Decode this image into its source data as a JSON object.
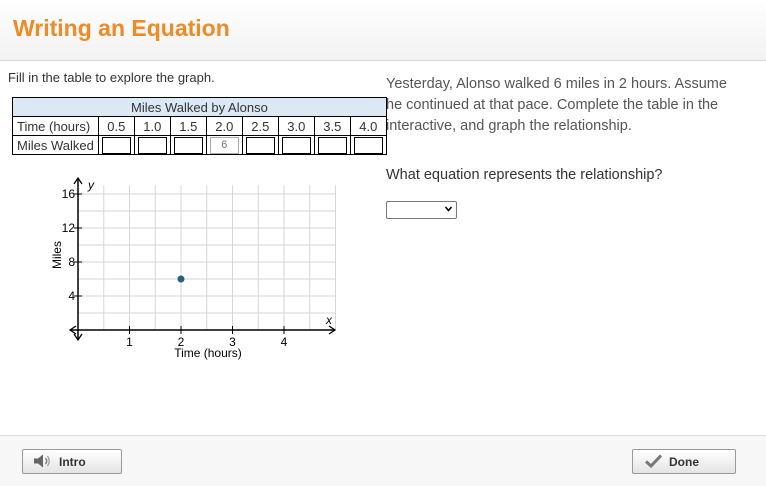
{
  "header": {
    "title": "Writing an Equation"
  },
  "left": {
    "instructions": "Fill in the table to explore the graph.",
    "table": {
      "caption": "Miles Walked by Alonso",
      "row1_label": "Time (hours)",
      "times": [
        "0.5",
        "1.0",
        "1.5",
        "2.0",
        "2.5",
        "3.0",
        "3.5",
        "4.0"
      ],
      "row2_label": "Miles Walked",
      "miles": [
        "",
        "",
        "",
        "6",
        "",
        "",
        "",
        ""
      ]
    },
    "graph": {
      "y_var": "y",
      "x_var": "x",
      "ylabel": "Miles",
      "xlabel": "Time (hours)",
      "y_ticks": [
        "4",
        "8",
        "12",
        "16"
      ],
      "x_ticks": [
        "1",
        "2",
        "3",
        "4"
      ],
      "point_color": "#2b5f7a"
    }
  },
  "chart_data": {
    "type": "scatter",
    "x": [
      2
    ],
    "y": [
      6
    ],
    "xlabel": "Time (hours)",
    "ylabel": "Miles",
    "xlim": [
      0,
      5
    ],
    "ylim": [
      0,
      17
    ],
    "grid": true
  },
  "right": {
    "prompt": "Yesterday, Alonso walked 6 miles in 2 hours. Assume he continued at that pace. Complete the table in the interactive, and graph the relationship.",
    "question": "What equation represents the relationship?",
    "dropdown_value": ""
  },
  "footer": {
    "intro_label": "Intro",
    "done_label": "Done"
  },
  "colors": {
    "title": "#f08a24",
    "table_header_bg": "#dbe9f6"
  }
}
